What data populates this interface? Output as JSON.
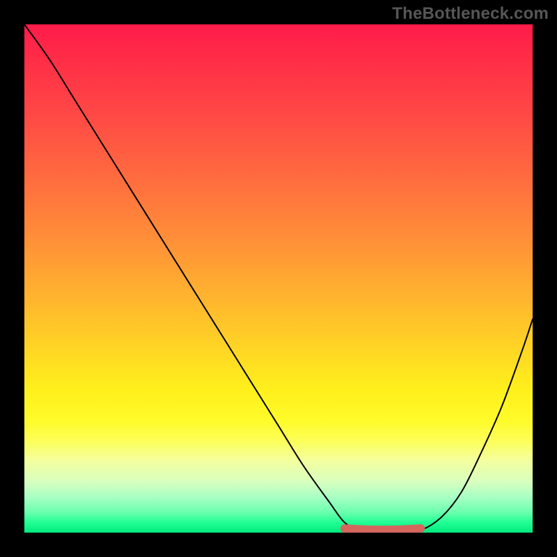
{
  "watermark": "TheBottleneck.com",
  "colors": {
    "frame": "#000000",
    "watermark": "#565656",
    "curve": "#000000",
    "highlight": "#d4665e",
    "gradient_top": "#ff1b4a",
    "gradient_bottom": "#00e97e"
  },
  "chart_data": {
    "type": "line",
    "title": "",
    "xlabel": "",
    "ylabel": "",
    "xlim": [
      0,
      100
    ],
    "ylim": [
      0,
      100
    ],
    "grid": false,
    "legend": false,
    "series": [
      {
        "name": "bottleneck_curve",
        "x": [
          0,
          5,
          10,
          15,
          20,
          25,
          30,
          35,
          40,
          45,
          50,
          55,
          60,
          63,
          66,
          70,
          74,
          78,
          82,
          86,
          90,
          94,
          98,
          100
        ],
        "y": [
          100,
          93,
          85,
          77,
          69,
          61,
          53,
          45,
          37,
          29,
          21,
          13,
          6,
          2,
          0.5,
          0,
          0,
          0.5,
          3,
          8,
          16,
          25,
          36,
          42
        ]
      }
    ],
    "optimal_range": {
      "x_start": 63,
      "x_end": 78,
      "y": 0
    }
  }
}
